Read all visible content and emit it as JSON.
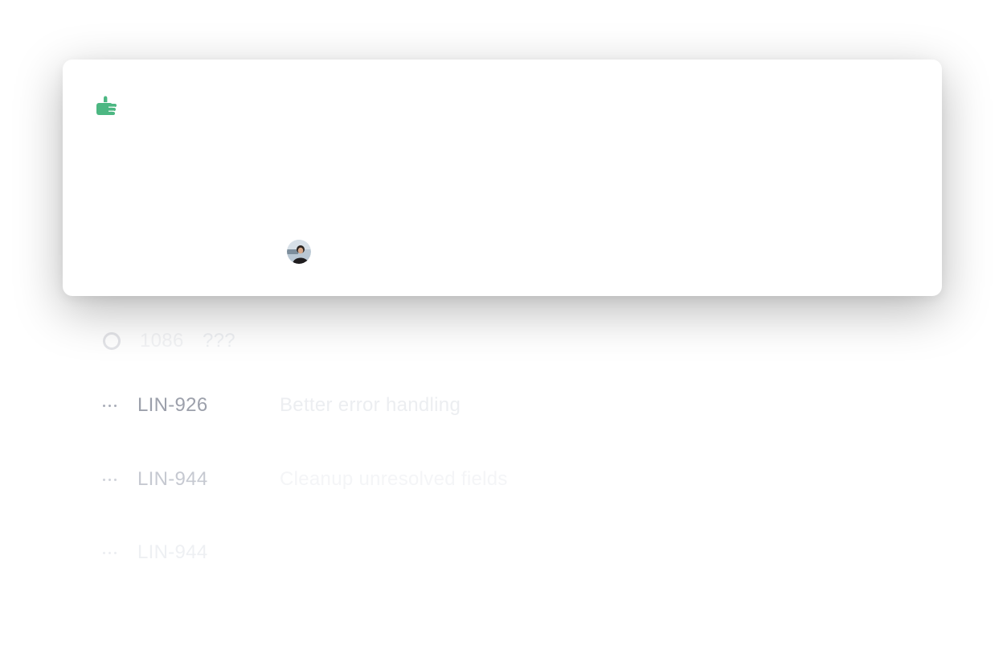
{
  "popover": {
    "reaction_icon": "thumbs-up-icon",
    "reaction_color": "#4cb782",
    "avatar_icon": "user-avatar"
  },
  "issues": [
    {
      "id": "1086",
      "extra": "???",
      "status_icon": "status-circle-icon"
    },
    {
      "id": "LIN-926",
      "title": "Better error handling",
      "menu_icon": "more-horizontal-icon"
    },
    {
      "id": "LIN-944",
      "title": "Cleanup unresolved fields",
      "menu_icon": "more-horizontal-icon"
    },
    {
      "id": "LIN-944",
      "menu_icon": "more-horizontal-icon"
    }
  ]
}
